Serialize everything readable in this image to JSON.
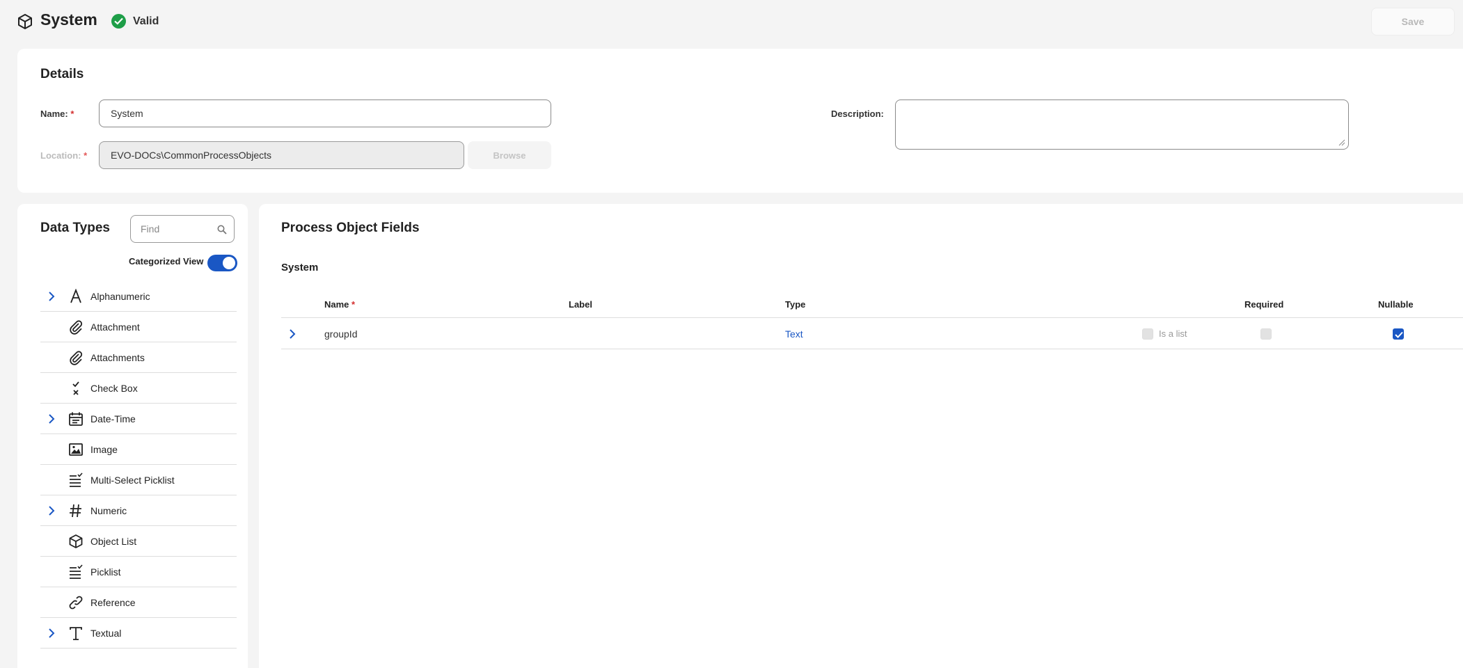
{
  "header": {
    "title": "System",
    "status": "Valid",
    "save_label": "Save",
    "colors": {
      "valid": "#1e9e48",
      "accent": "#1a57c4"
    }
  },
  "details": {
    "heading": "Details",
    "name_label": "Name:",
    "name_value": "System",
    "location_label": "Location:",
    "location_value": "EVO-DOCs\\CommonProcessObjects",
    "browse_label": "Browse",
    "description_label": "Description:",
    "description_value": "",
    "required_marker": "*"
  },
  "data_types": {
    "heading": "Data Types",
    "find_placeholder": "Find",
    "categorized_label": "Categorized View",
    "categorized_on": true,
    "items": [
      {
        "label": "Alphanumeric",
        "icon": "letter-a-icon",
        "expandable": true
      },
      {
        "label": "Attachment",
        "icon": "paperclip-icon",
        "expandable": false
      },
      {
        "label": "Attachments",
        "icon": "paperclip-icon",
        "expandable": false
      },
      {
        "label": "Check Box",
        "icon": "checkbox-icon",
        "expandable": false
      },
      {
        "label": "Date-Time",
        "icon": "calendar-icon",
        "expandable": true
      },
      {
        "label": "Image",
        "icon": "image-icon",
        "expandable": false
      },
      {
        "label": "Multi-Select Picklist",
        "icon": "list-check-icon",
        "expandable": false
      },
      {
        "label": "Numeric",
        "icon": "hash-icon",
        "expandable": true
      },
      {
        "label": "Object List",
        "icon": "cube-icon",
        "expandable": false
      },
      {
        "label": "Picklist",
        "icon": "list-check-icon",
        "expandable": false
      },
      {
        "label": "Reference",
        "icon": "link-icon",
        "expandable": false
      },
      {
        "label": "Textual",
        "icon": "letter-t-icon",
        "expandable": true
      }
    ]
  },
  "fields": {
    "heading": "Process Object Fields",
    "group": "System",
    "columns": {
      "name": "Name",
      "label": "Label",
      "type": "Type",
      "required": "Required",
      "nullable": "Nullable"
    },
    "rows": [
      {
        "name": "groupId",
        "label": "",
        "type": "Text",
        "is_list_label": "Is a list",
        "is_list": false,
        "required": false,
        "nullable": true
      }
    ]
  }
}
